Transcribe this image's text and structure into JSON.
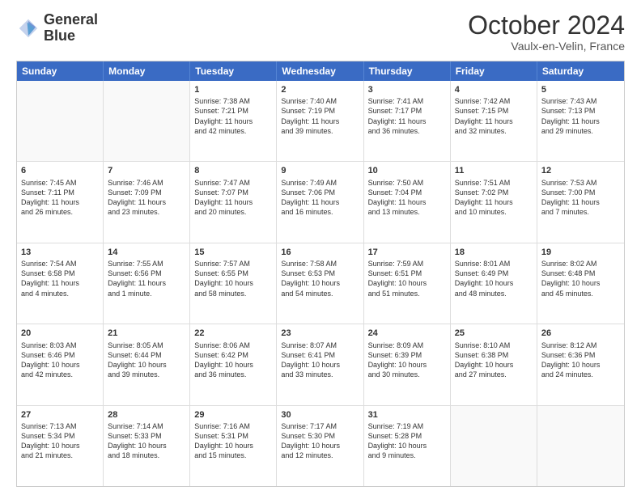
{
  "logo": {
    "line1": "General",
    "line2": "Blue"
  },
  "title": "October 2024",
  "location": "Vaulx-en-Velin, France",
  "days_of_week": [
    "Sunday",
    "Monday",
    "Tuesday",
    "Wednesday",
    "Thursday",
    "Friday",
    "Saturday"
  ],
  "rows": [
    [
      {
        "day": "",
        "lines": []
      },
      {
        "day": "",
        "lines": []
      },
      {
        "day": "1",
        "lines": [
          "Sunrise: 7:38 AM",
          "Sunset: 7:21 PM",
          "Daylight: 11 hours",
          "and 42 minutes."
        ]
      },
      {
        "day": "2",
        "lines": [
          "Sunrise: 7:40 AM",
          "Sunset: 7:19 PM",
          "Daylight: 11 hours",
          "and 39 minutes."
        ]
      },
      {
        "day": "3",
        "lines": [
          "Sunrise: 7:41 AM",
          "Sunset: 7:17 PM",
          "Daylight: 11 hours",
          "and 36 minutes."
        ]
      },
      {
        "day": "4",
        "lines": [
          "Sunrise: 7:42 AM",
          "Sunset: 7:15 PM",
          "Daylight: 11 hours",
          "and 32 minutes."
        ]
      },
      {
        "day": "5",
        "lines": [
          "Sunrise: 7:43 AM",
          "Sunset: 7:13 PM",
          "Daylight: 11 hours",
          "and 29 minutes."
        ]
      }
    ],
    [
      {
        "day": "6",
        "lines": [
          "Sunrise: 7:45 AM",
          "Sunset: 7:11 PM",
          "Daylight: 11 hours",
          "and 26 minutes."
        ]
      },
      {
        "day": "7",
        "lines": [
          "Sunrise: 7:46 AM",
          "Sunset: 7:09 PM",
          "Daylight: 11 hours",
          "and 23 minutes."
        ]
      },
      {
        "day": "8",
        "lines": [
          "Sunrise: 7:47 AM",
          "Sunset: 7:07 PM",
          "Daylight: 11 hours",
          "and 20 minutes."
        ]
      },
      {
        "day": "9",
        "lines": [
          "Sunrise: 7:49 AM",
          "Sunset: 7:06 PM",
          "Daylight: 11 hours",
          "and 16 minutes."
        ]
      },
      {
        "day": "10",
        "lines": [
          "Sunrise: 7:50 AM",
          "Sunset: 7:04 PM",
          "Daylight: 11 hours",
          "and 13 minutes."
        ]
      },
      {
        "day": "11",
        "lines": [
          "Sunrise: 7:51 AM",
          "Sunset: 7:02 PM",
          "Daylight: 11 hours",
          "and 10 minutes."
        ]
      },
      {
        "day": "12",
        "lines": [
          "Sunrise: 7:53 AM",
          "Sunset: 7:00 PM",
          "Daylight: 11 hours",
          "and 7 minutes."
        ]
      }
    ],
    [
      {
        "day": "13",
        "lines": [
          "Sunrise: 7:54 AM",
          "Sunset: 6:58 PM",
          "Daylight: 11 hours",
          "and 4 minutes."
        ]
      },
      {
        "day": "14",
        "lines": [
          "Sunrise: 7:55 AM",
          "Sunset: 6:56 PM",
          "Daylight: 11 hours",
          "and 1 minute."
        ]
      },
      {
        "day": "15",
        "lines": [
          "Sunrise: 7:57 AM",
          "Sunset: 6:55 PM",
          "Daylight: 10 hours",
          "and 58 minutes."
        ]
      },
      {
        "day": "16",
        "lines": [
          "Sunrise: 7:58 AM",
          "Sunset: 6:53 PM",
          "Daylight: 10 hours",
          "and 54 minutes."
        ]
      },
      {
        "day": "17",
        "lines": [
          "Sunrise: 7:59 AM",
          "Sunset: 6:51 PM",
          "Daylight: 10 hours",
          "and 51 minutes."
        ]
      },
      {
        "day": "18",
        "lines": [
          "Sunrise: 8:01 AM",
          "Sunset: 6:49 PM",
          "Daylight: 10 hours",
          "and 48 minutes."
        ]
      },
      {
        "day": "19",
        "lines": [
          "Sunrise: 8:02 AM",
          "Sunset: 6:48 PM",
          "Daylight: 10 hours",
          "and 45 minutes."
        ]
      }
    ],
    [
      {
        "day": "20",
        "lines": [
          "Sunrise: 8:03 AM",
          "Sunset: 6:46 PM",
          "Daylight: 10 hours",
          "and 42 minutes."
        ]
      },
      {
        "day": "21",
        "lines": [
          "Sunrise: 8:05 AM",
          "Sunset: 6:44 PM",
          "Daylight: 10 hours",
          "and 39 minutes."
        ]
      },
      {
        "day": "22",
        "lines": [
          "Sunrise: 8:06 AM",
          "Sunset: 6:42 PM",
          "Daylight: 10 hours",
          "and 36 minutes."
        ]
      },
      {
        "day": "23",
        "lines": [
          "Sunrise: 8:07 AM",
          "Sunset: 6:41 PM",
          "Daylight: 10 hours",
          "and 33 minutes."
        ]
      },
      {
        "day": "24",
        "lines": [
          "Sunrise: 8:09 AM",
          "Sunset: 6:39 PM",
          "Daylight: 10 hours",
          "and 30 minutes."
        ]
      },
      {
        "day": "25",
        "lines": [
          "Sunrise: 8:10 AM",
          "Sunset: 6:38 PM",
          "Daylight: 10 hours",
          "and 27 minutes."
        ]
      },
      {
        "day": "26",
        "lines": [
          "Sunrise: 8:12 AM",
          "Sunset: 6:36 PM",
          "Daylight: 10 hours",
          "and 24 minutes."
        ]
      }
    ],
    [
      {
        "day": "27",
        "lines": [
          "Sunrise: 7:13 AM",
          "Sunset: 5:34 PM",
          "Daylight: 10 hours",
          "and 21 minutes."
        ]
      },
      {
        "day": "28",
        "lines": [
          "Sunrise: 7:14 AM",
          "Sunset: 5:33 PM",
          "Daylight: 10 hours",
          "and 18 minutes."
        ]
      },
      {
        "day": "29",
        "lines": [
          "Sunrise: 7:16 AM",
          "Sunset: 5:31 PM",
          "Daylight: 10 hours",
          "and 15 minutes."
        ]
      },
      {
        "day": "30",
        "lines": [
          "Sunrise: 7:17 AM",
          "Sunset: 5:30 PM",
          "Daylight: 10 hours",
          "and 12 minutes."
        ]
      },
      {
        "day": "31",
        "lines": [
          "Sunrise: 7:19 AM",
          "Sunset: 5:28 PM",
          "Daylight: 10 hours",
          "and 9 minutes."
        ]
      },
      {
        "day": "",
        "lines": []
      },
      {
        "day": "",
        "lines": []
      }
    ]
  ]
}
